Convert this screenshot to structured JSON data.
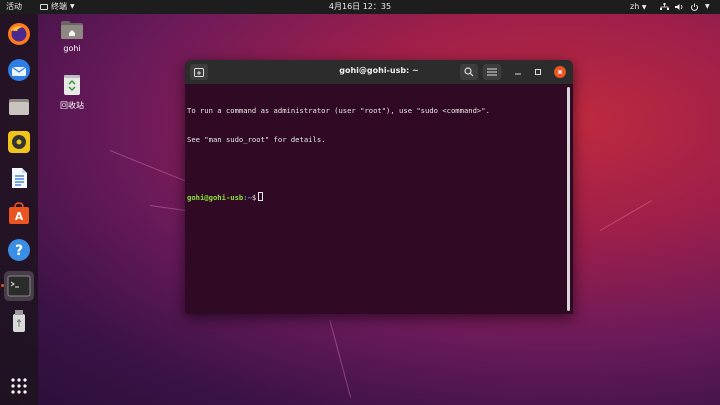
{
  "topbar": {
    "activities": "活动",
    "app_name": "终端",
    "clock": "4月16日  12：35",
    "language": "zh"
  },
  "dock": {
    "items": [
      {
        "name": "firefox",
        "icon": "firefox-icon"
      },
      {
        "name": "thunderbird",
        "icon": "thunderbird-icon"
      },
      {
        "name": "files",
        "icon": "files-icon"
      },
      {
        "name": "rhythmbox",
        "icon": "rhythmbox-icon"
      },
      {
        "name": "libreoffice-writer",
        "icon": "writer-icon"
      },
      {
        "name": "ubuntu-software",
        "icon": "software-icon"
      },
      {
        "name": "help",
        "icon": "help-icon"
      },
      {
        "name": "terminal",
        "icon": "terminal-icon",
        "active": true
      },
      {
        "name": "usb-drive",
        "icon": "usb-drive-icon"
      },
      {
        "name": "show-applications",
        "icon": "app-grid-icon"
      }
    ]
  },
  "desktop": {
    "home_label": "gohi",
    "trash_label": "回收站"
  },
  "terminal": {
    "title": "gohi@gohi-usb: ~",
    "lines": [
      "To run a command as administrator (user \"root\"), use \"sudo <command>\".",
      "See \"man sudo_root\" for details."
    ],
    "prompt_user": "gohi@gohi-usb",
    "prompt_path": ":~",
    "prompt_symbol": "$"
  },
  "colors": {
    "accent": "#e95420",
    "terminal_bg": "#300a24",
    "prompt_user": "#8ae234",
    "prompt_path": "#729fcf"
  }
}
